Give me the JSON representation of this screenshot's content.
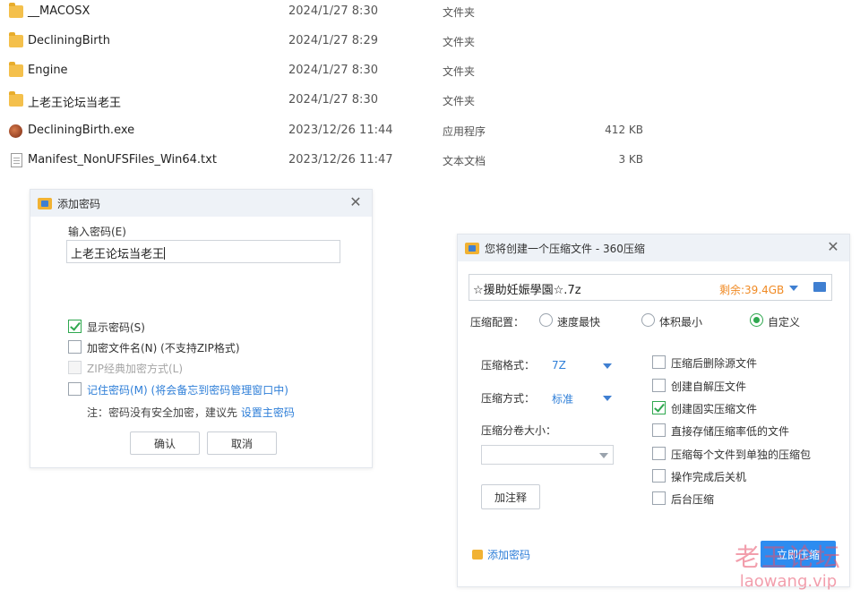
{
  "files": [
    {
      "icon": "folder-icon",
      "name": "__MACOSX",
      "date": "2024/1/27 8:30",
      "type": "文件夹",
      "size": ""
    },
    {
      "icon": "folder-icon",
      "name": "DecliningBirth",
      "date": "2024/1/27 8:29",
      "type": "文件夹",
      "size": ""
    },
    {
      "icon": "folder-icon",
      "name": "Engine",
      "date": "2024/1/27 8:30",
      "type": "文件夹",
      "size": ""
    },
    {
      "icon": "folder-icon",
      "name": "上老王论坛当老王",
      "date": "2024/1/27 8:30",
      "type": "文件夹",
      "size": ""
    },
    {
      "icon": "exe-icon",
      "name": "DecliningBirth.exe",
      "date": "2023/12/26 11:44",
      "type": "应用程序",
      "size": "412 KB"
    },
    {
      "icon": "txt-icon",
      "name": "Manifest_NonUFSFiles_Win64.txt",
      "date": "2023/12/26 11:47",
      "type": "文本文档",
      "size": "3 KB"
    }
  ],
  "password_dialog": {
    "title": "添加密码",
    "close": "✕",
    "input_label": "输入密码(E)",
    "password_value": "上老王论坛当老王",
    "show_password": "显示密码(S)",
    "encrypt_filenames": "加密文件名(N) (不支持ZIP格式)",
    "zip_classic": "ZIP经典加密方式(L)",
    "remember_password": "记住密码(M) (将会备忘到密码管理窗口中)",
    "note_prefix": "注：密码没有安全加密，建议先",
    "note_link": "设置主密码",
    "ok": "确认",
    "cancel": "取消"
  },
  "compress_dialog": {
    "title": "您将创建一个压缩文件 - 360压缩",
    "close": "✕",
    "filename": "☆援助妊娠學園☆.7z",
    "free_space": "剩余:39.4GB",
    "config_label": "压缩配置：",
    "opt_fastest": "速度最快",
    "opt_smallest": "体积最小",
    "opt_custom": "自定义",
    "format_label": "压缩格式：",
    "format_value": "7Z",
    "method_label": "压缩方式：",
    "method_value": "标准",
    "split_label": "压缩分卷大小：",
    "comment_button": "加注释",
    "checks": [
      {
        "label": "压缩后删除源文件",
        "checked": false
      },
      {
        "label": "创建自解压文件",
        "checked": false
      },
      {
        "label": "创建固实压缩文件",
        "checked": true
      },
      {
        "label": "直接存储压缩率低的文件",
        "checked": false
      },
      {
        "label": "压缩每个文件到单独的压缩包",
        "checked": false
      },
      {
        "label": "操作完成后关机",
        "checked": false
      },
      {
        "label": "后台压缩",
        "checked": false
      }
    ],
    "add_password": "添加密码",
    "start_button": "立即压缩"
  },
  "watermark": {
    "line1": "老王论坛",
    "line2": "laowang.vip"
  },
  "colors": {
    "accent": "#3f7fd1",
    "checked": "#2fa84f",
    "free_space": "#f08a24",
    "link": "#2f7fd8",
    "start": "#2d8cf0"
  }
}
